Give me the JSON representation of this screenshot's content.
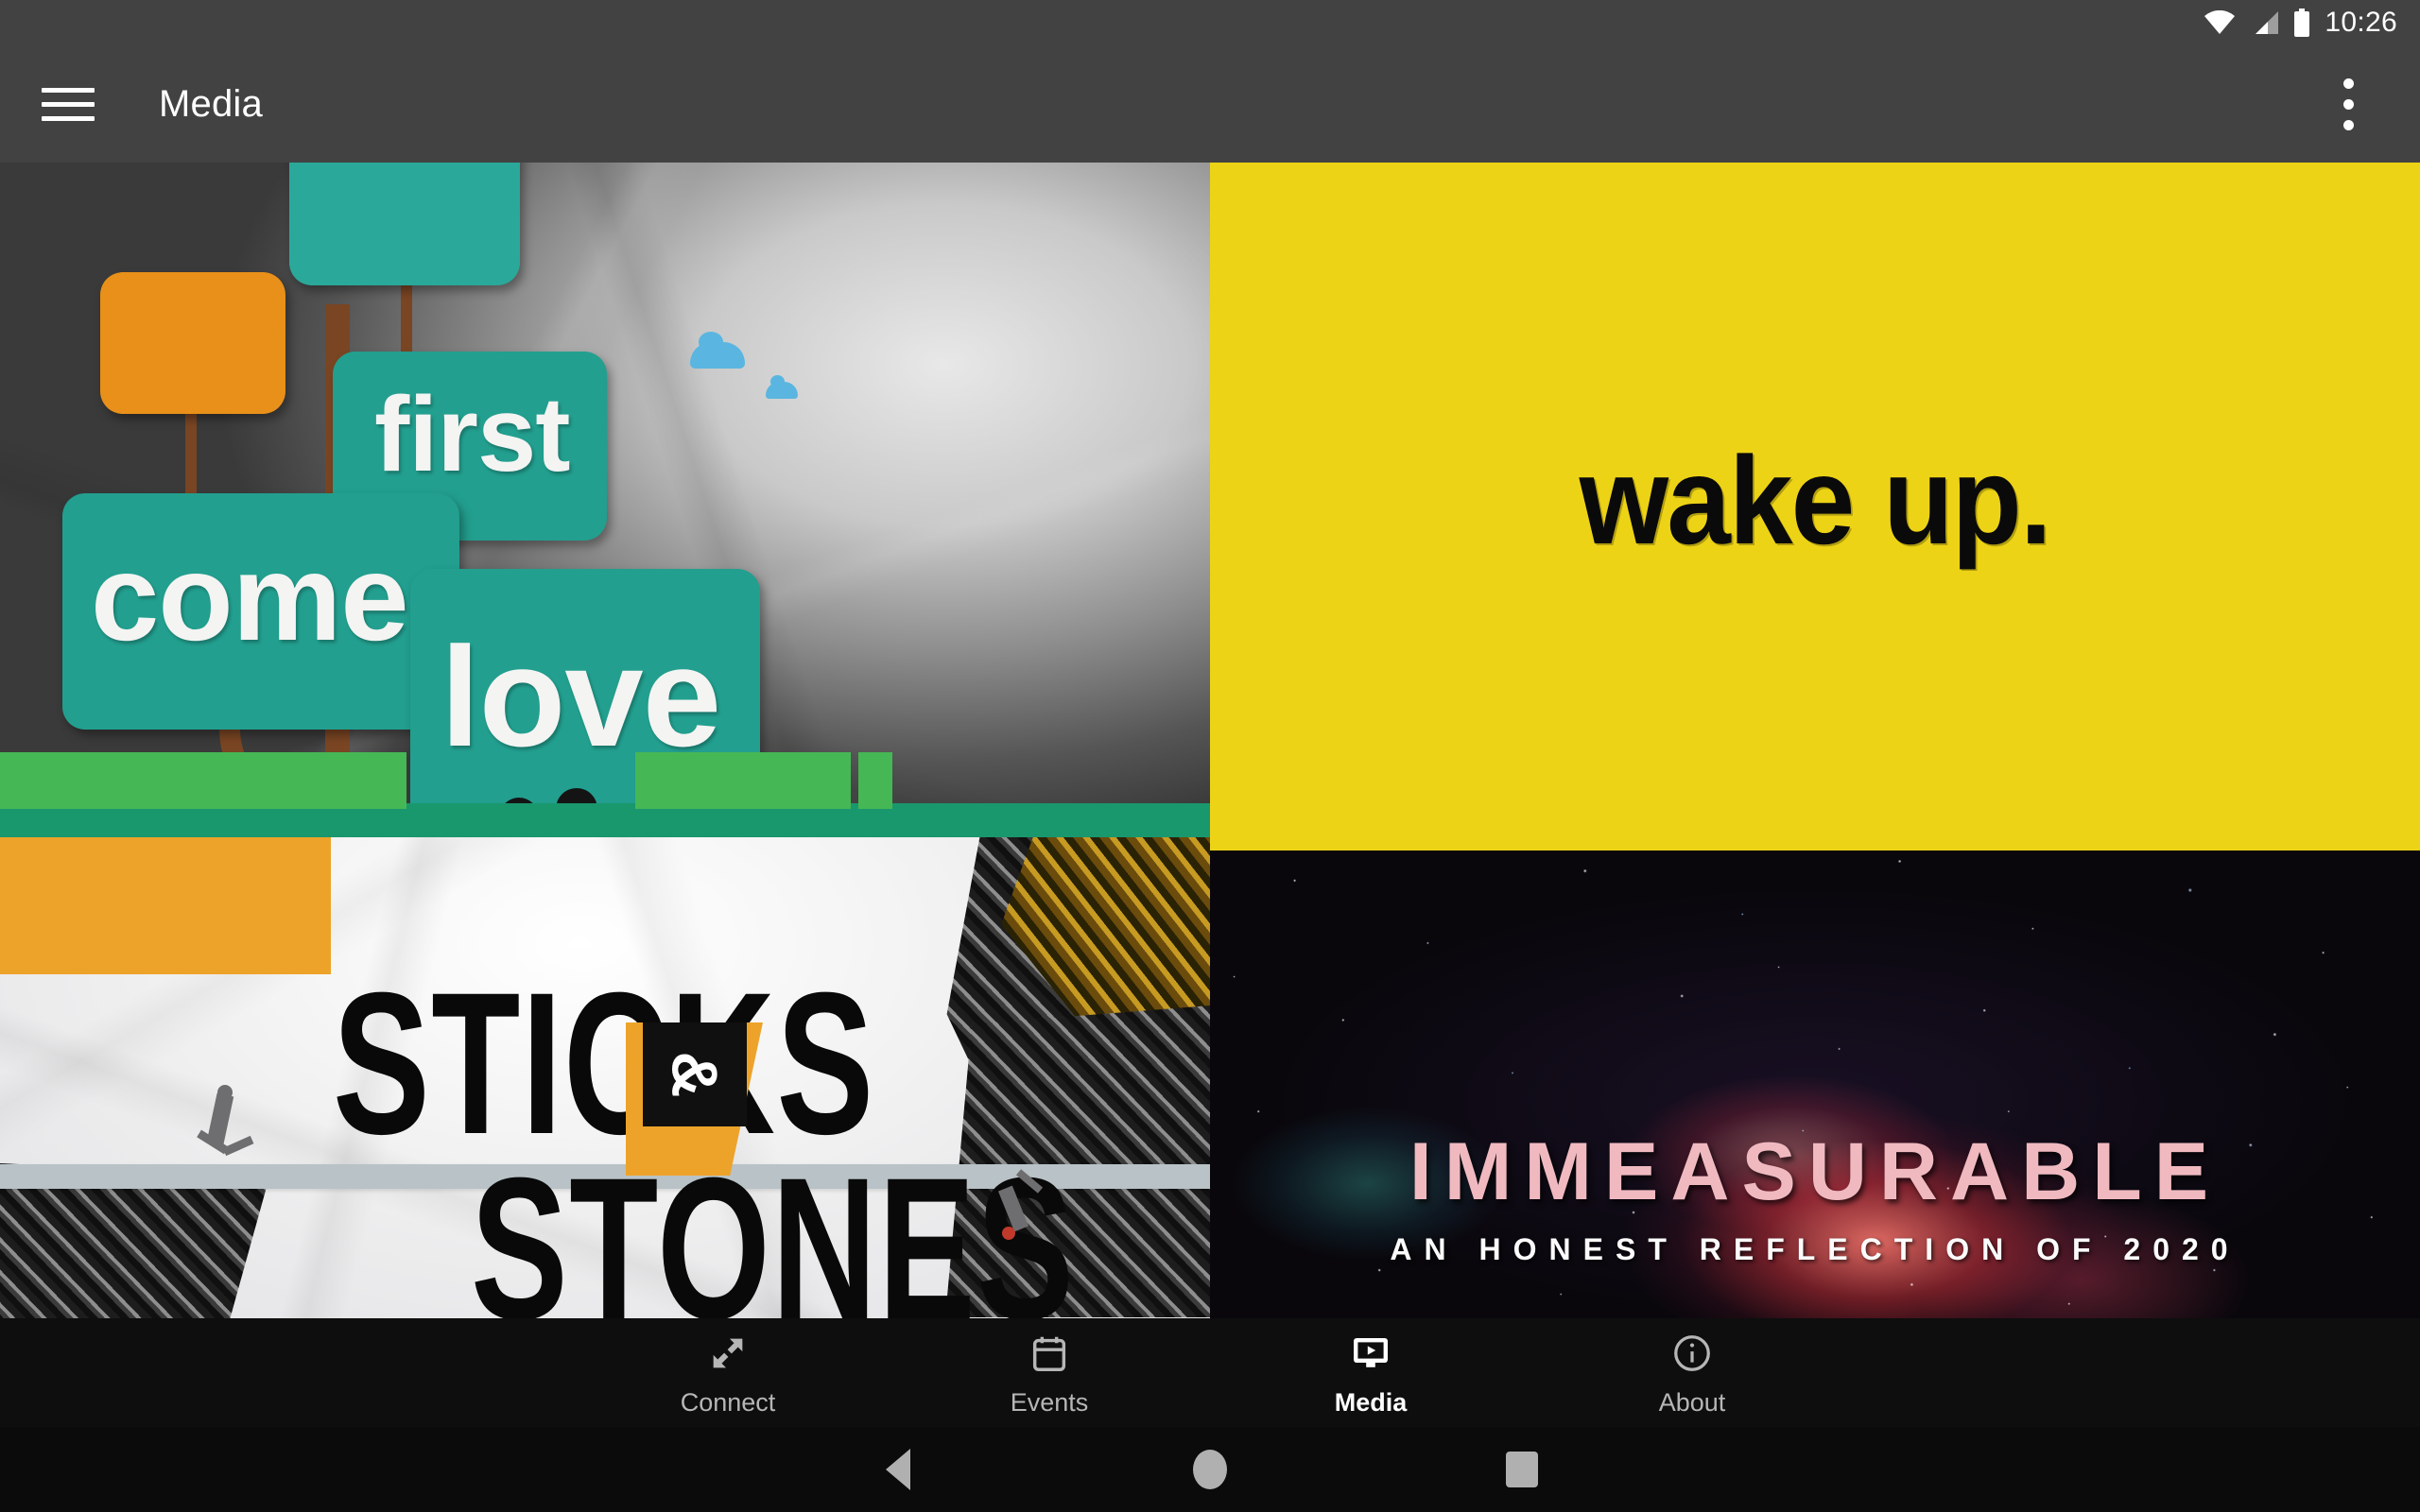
{
  "status_bar": {
    "time": "10:26",
    "icons": [
      "wifi-icon",
      "cellular-signal-icon",
      "battery-icon"
    ]
  },
  "app_bar": {
    "menu_icon": "hamburger-menu-icon",
    "title": "Media",
    "overflow_icon": "more-vert-icon"
  },
  "media_grid": {
    "tiles": [
      {
        "name": "first-comes-love",
        "words": {
          "first": "first",
          "comes": "comes",
          "love": "love"
        },
        "colors": {
          "bubble": "#229f8f",
          "accent": "#e89019",
          "grass": "#19986d"
        }
      },
      {
        "name": "wake-up",
        "title": "wake up.",
        "colors": {
          "background": "#edd316",
          "text": "#0a0a0a"
        }
      },
      {
        "name": "sticks-and-stones",
        "line1": "STICKS",
        "ampersand": "&",
        "line2": "STONES",
        "colors": {
          "background": "#f2f2f4",
          "accent": "#eda32a",
          "text": "#090909"
        }
      },
      {
        "name": "immeasurable",
        "title": "IMMEASURABLE",
        "subtitle": "AN HONEST REFLECTION OF 2020",
        "colors": {
          "title": "#f0b9c0",
          "subtitle": "#fbfbfb",
          "background": "#09070c"
        }
      }
    ]
  },
  "bottom_nav": {
    "items": [
      {
        "label": "Connect",
        "icon": "collapse-arrows-icon",
        "active": false
      },
      {
        "label": "Events",
        "icon": "calendar-icon",
        "active": false
      },
      {
        "label": "Media",
        "icon": "tv-play-icon",
        "active": true
      },
      {
        "label": "About",
        "icon": "info-circle-icon",
        "active": false
      }
    ],
    "active_color": "#ffffff",
    "inactive_color": "#b6b6b6"
  },
  "android_nav": {
    "buttons": [
      "back-button",
      "home-button",
      "recents-button"
    ]
  }
}
